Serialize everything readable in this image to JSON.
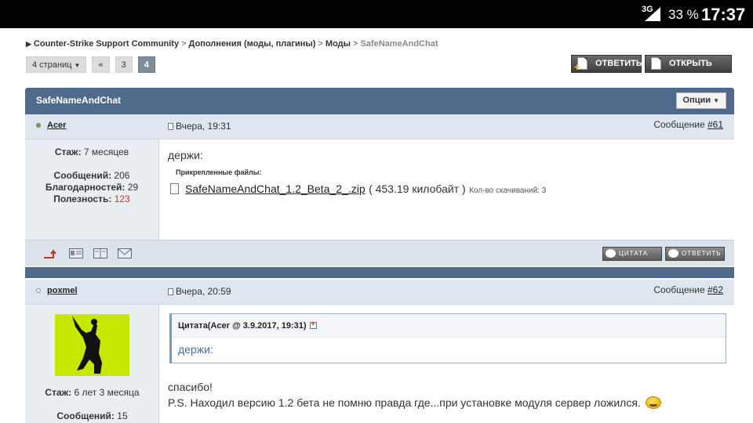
{
  "status_bar": {
    "network": "3G",
    "battery": "33 %",
    "time": "17:37"
  },
  "breadcrumb": {
    "items": [
      "Counter-Strike Support Community",
      "Дополнения (моды, плагины)",
      "Моды"
    ],
    "current": "SafeNameAndChat"
  },
  "pagination": {
    "pages_label": "4 страниц",
    "prev": "«",
    "pages": [
      "3",
      "4"
    ],
    "active": "4"
  },
  "actions": {
    "reply": "ОТВЕТИТЬ",
    "new_topic": "ОТКРЫТЬ ТЕМУ"
  },
  "topic": {
    "title": "SafeNameAndChat",
    "options": "Опции"
  },
  "posts": [
    {
      "author": "Acer",
      "status": "online",
      "date": "Вчера, 19:31",
      "msg_label": "Сообщение",
      "msg_num": "#61",
      "stats": {
        "tenure_label": "Стаж:",
        "tenure": "7 месяцев",
        "posts_label": "Сообщений:",
        "posts": "206",
        "thanks_label": "Благодарностей:",
        "thanks": "29",
        "useful_label": "Полезность:",
        "useful": "123"
      },
      "text": "держи:",
      "attach_label": "Прикрепленные файлы:",
      "file": {
        "name": "SafeNameAndChat_1.2_Beta_2_.zip",
        "size": "( 453.19 килобайт )",
        "downloads": "Кол-во скачиваний: 3"
      },
      "footer_buttons": {
        "quote": "ЦИТАТА",
        "reply": "ОТВЕТИТЬ"
      },
      "footer_icons": [
        "arrow-up-icon",
        "profile-card-icon",
        "book-icon",
        "envelope-icon"
      ]
    },
    {
      "author": "poxmel",
      "status": "offline",
      "date": "Вчера, 20:59",
      "msg_label": "Сообщение",
      "msg_num": "#62",
      "stats": {
        "tenure_label": "Стаж:",
        "tenure": "6 лет 3 месяца",
        "posts_label": "Сообщений:",
        "posts": "15"
      },
      "quote": {
        "head": "Цитата(Acer @ 3.9.2017, 19:31)",
        "text": "держи:"
      },
      "text_lines": [
        "спасибо!",
        "P.S. Находил версию 1.2 бета не помню правда где...при установке модуля сервер ложился."
      ],
      "avatar_icon": "dancer-silhouette-icon"
    }
  ],
  "colors": {
    "header_bar": "#506a8c",
    "post_meta_bg": "#dfe6ef",
    "sidebar_bg": "#e9eef3",
    "useful_red": "#d83030"
  }
}
